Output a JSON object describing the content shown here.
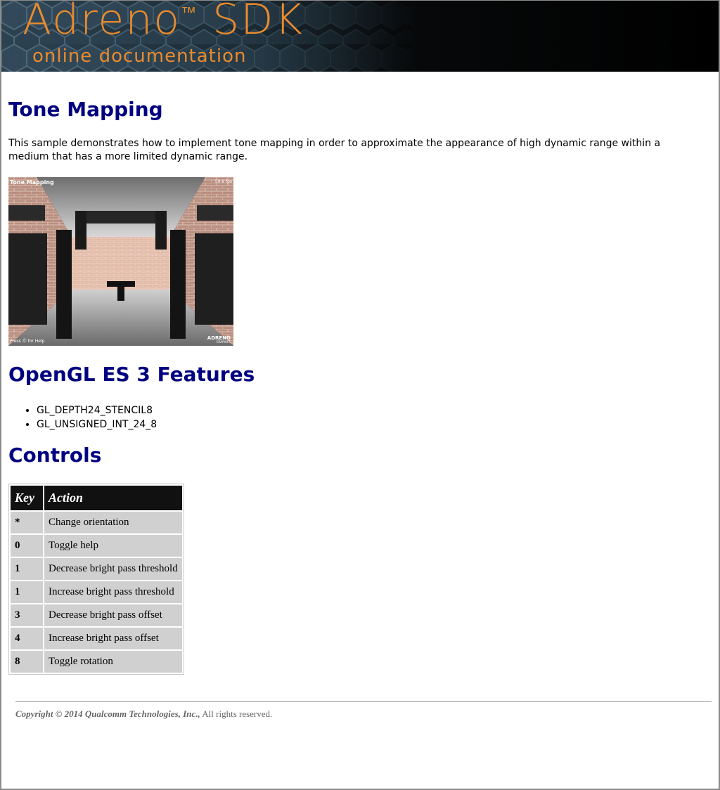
{
  "header": {
    "logo_title": "Adreno",
    "logo_tm": "™",
    "logo_sdk": "SDK",
    "logo_subtitle": "online documentation"
  },
  "page": {
    "title": "Tone Mapping",
    "intro": "This sample demonstrates how to implement tone mapping in order to approximate the appearance of high dynamic range within a medium that has a more limited dynamic range."
  },
  "screenshot": {
    "caption_title": "Tone Mapping",
    "fps": "59.9 fps",
    "help_hint": "Press ⓪ for Help",
    "brand": "ADRENO",
    "brand_sub": "GRAPHICS"
  },
  "features": {
    "heading": "OpenGL ES 3 Features",
    "items": [
      "GL_DEPTH24_STENCIL8",
      "GL_UNSIGNED_INT_24_8"
    ]
  },
  "controls": {
    "heading": "Controls",
    "headers": [
      "Key",
      "Action"
    ],
    "rows": [
      {
        "key": "*",
        "action": "Change orientation"
      },
      {
        "key": "0",
        "action": "Toggle help"
      },
      {
        "key": "1",
        "action": "Decrease bright pass threshold"
      },
      {
        "key": "1",
        "action": "Increase bright pass threshold"
      },
      {
        "key": "3",
        "action": "Decrease bright pass offset"
      },
      {
        "key": "4",
        "action": "Increase bright pass offset"
      },
      {
        "key": "8",
        "action": "Toggle rotation"
      }
    ]
  },
  "footer": {
    "copyright_prefix": "Copyright © 2014 Qualcomm Technologies, Inc.,",
    "copyright_suffix": " All rights reserved."
  },
  "colors": {
    "heading": "#000080",
    "logo_orange": "#e98b2e",
    "table_header_bg": "#111111",
    "table_cell_bg": "#d0d0d0"
  }
}
